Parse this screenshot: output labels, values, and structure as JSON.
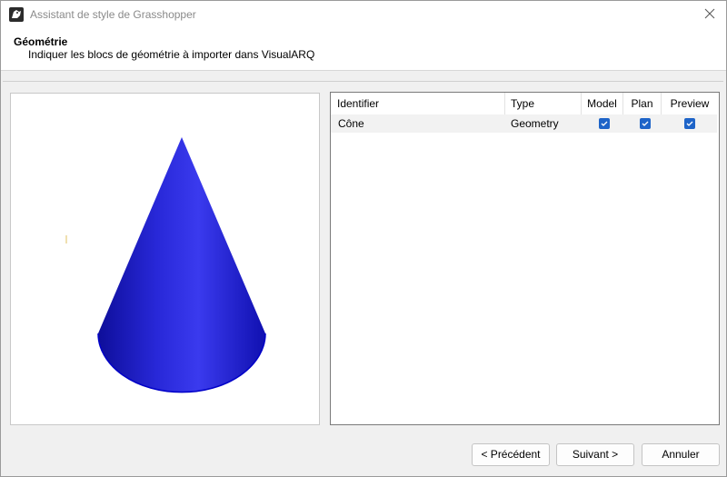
{
  "window": {
    "title": "Assistant de style de Grasshopper",
    "icon": "rhino-app-icon",
    "close_icon": "close-icon"
  },
  "header": {
    "title": "Géométrie",
    "subtitle": "Indiquer les blocs de géométrie à importer dans VisualARQ"
  },
  "preview": {
    "object": "cone",
    "cone_color": "#2020d8",
    "outline_color": "#0000c8"
  },
  "table": {
    "columns": [
      {
        "label": "Identifier"
      },
      {
        "label": "Type"
      },
      {
        "label": "Model"
      },
      {
        "label": "Plan"
      },
      {
        "label": "Preview"
      }
    ],
    "rows": [
      {
        "identifier": "Cône",
        "type": "Geometry",
        "model": true,
        "plan": true,
        "preview": true
      }
    ],
    "checkbox_color": "#1e64c8"
  },
  "footer": {
    "prev_label": "< Précédent",
    "next_label": "Suivant >",
    "cancel_label": "Annuler"
  }
}
